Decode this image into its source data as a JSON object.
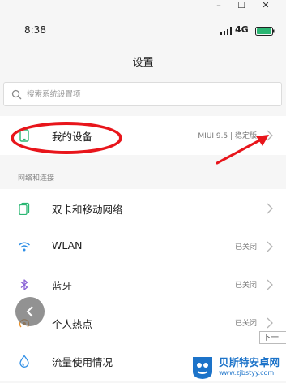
{
  "window": {
    "minimize_icon": "minimize-icon",
    "maximize_icon": "maximize-icon",
    "close_icon": "close-icon"
  },
  "status_bar": {
    "time": "8:38",
    "network": "4G"
  },
  "header": {
    "title": "设置"
  },
  "search": {
    "placeholder": "搜索系统设置项"
  },
  "device_row": {
    "label": "我的设备",
    "value": "MIUI 9.5 | 稳定版"
  },
  "section": {
    "label": "网络和连接"
  },
  "rows": [
    {
      "label": "双卡和移动网络",
      "value": "",
      "icon": "sim-card-icon"
    },
    {
      "label": "WLAN",
      "value": "已关闭",
      "icon": "wifi-icon"
    },
    {
      "label": "蓝牙",
      "value": "已关闭",
      "icon": "bluetooth-icon"
    },
    {
      "label": "个人热点",
      "value": "已关闭",
      "icon": "hotspot-icon"
    },
    {
      "label": "流量使用情况",
      "value": "",
      "icon": "data-drop-icon"
    }
  ],
  "overlay": {
    "next_tip": "下一"
  },
  "watermark": {
    "title": "贝斯特安卓网",
    "url": "www.zjbstyy.com"
  },
  "colors": {
    "accent_green": "#2bb673",
    "accent_blue": "#2f8fe6",
    "accent_purple": "#8a62d6",
    "annotation_red": "#e8151b"
  }
}
